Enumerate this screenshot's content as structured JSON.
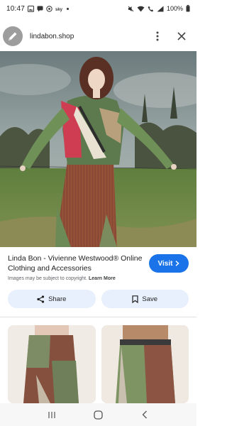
{
  "status_bar": {
    "time": "10:47",
    "left_icons": [
      "gallery-icon",
      "message-icon",
      "whatsapp-icon",
      "news-icon",
      "dot-icon"
    ],
    "right_icons": [
      "mute-icon",
      "wifi-icon",
      "call-icon",
      "signal-icon"
    ],
    "battery": "100%"
  },
  "top_bar": {
    "site": "lindabon.shop",
    "menu_icon": "more-vert-icon",
    "close_icon": "close-icon"
  },
  "result": {
    "title": "Linda Bon - Vivienne Westwood® Online Clothing and Accessories",
    "copyright_text": "Images may be subject to copyright.",
    "learn_more": "Learn More",
    "visit_label": "Visit",
    "share_label": "Share",
    "save_label": "Save"
  },
  "colors": {
    "accent": "#1a73e8",
    "chip_bg": "#e8f0fe"
  },
  "nav_bar": {
    "buttons": [
      "recents-icon",
      "home-icon",
      "back-icon"
    ]
  }
}
